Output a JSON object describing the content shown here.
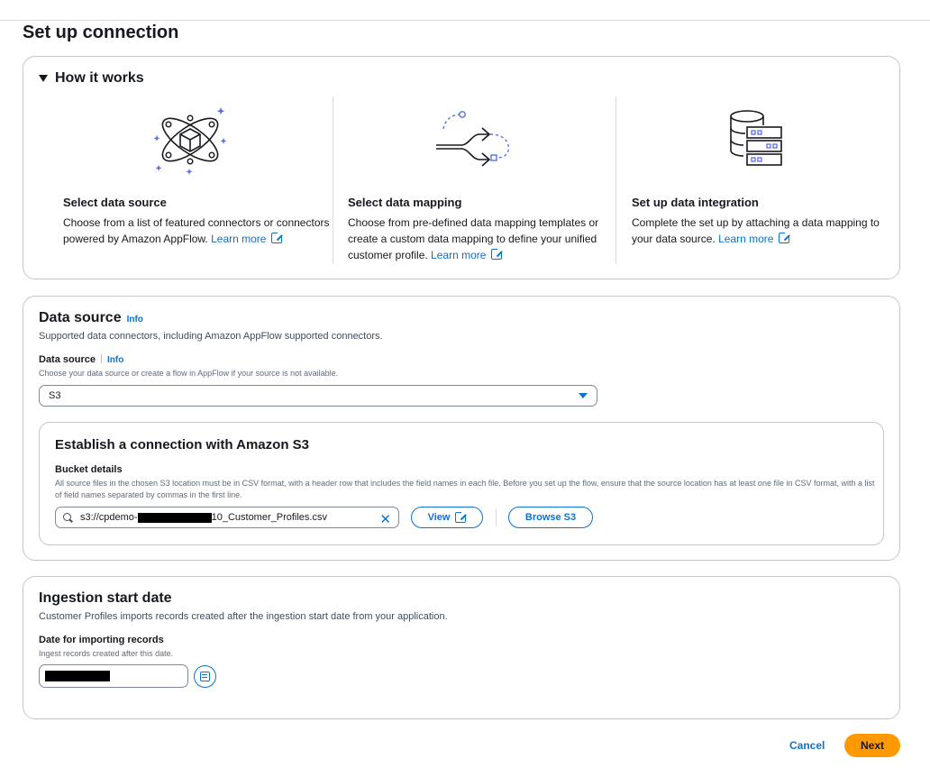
{
  "page": {
    "title": "Set up connection"
  },
  "how_it_works": {
    "header": "How it works",
    "steps": [
      {
        "icon": "connector-orbit-icon",
        "title": "Select data source",
        "desc": "Choose from a list of featured connectors or connectors powered by Amazon AppFlow.",
        "link": "Learn more"
      },
      {
        "icon": "data-mapping-arrows-icon",
        "title": "Select data mapping",
        "desc": "Choose from pre-defined data mapping templates or create a custom data mapping to define your unified customer profile.",
        "link": "Learn more"
      },
      {
        "icon": "database-servers-icon",
        "title": "Set up data integration",
        "desc": "Complete the set up by attaching a data mapping to your data source.",
        "link": "Learn more"
      }
    ]
  },
  "data_source": {
    "title": "Data source",
    "info": "Info",
    "subtitle": "Supported data connectors, including Amazon AppFlow supported connectors.",
    "field_label": "Data source",
    "field_info": "Info",
    "field_hint": "Choose your data source or create a flow in AppFlow if your source is not available.",
    "selected": "S3",
    "s3": {
      "title": "Establish a connection with Amazon S3",
      "bucket_label": "Bucket details",
      "bucket_hint": "All source files in the chosen S3 location must be in CSV format, with a header row that includes the field names in each file. Before you set up the flow, ensure that the source location has at least one file in CSV format, with a list of field names separated by commas in the first line.",
      "path_prefix": "s3://cpdemo-",
      "path_suffix": "10_Customer_Profiles.csv",
      "view_label": "View",
      "browse_label": "Browse S3"
    }
  },
  "ingestion": {
    "title": "Ingestion start date",
    "subtitle": "Customer Profiles imports records created after the ingestion start date from your application.",
    "date_label": "Date for importing records",
    "date_hint": "Ingest records created after this date."
  },
  "footer": {
    "cancel": "Cancel",
    "next": "Next"
  },
  "colors": {
    "link": "#0972d3",
    "primary_button": "#ff9900",
    "border": "#c6c6cd"
  }
}
